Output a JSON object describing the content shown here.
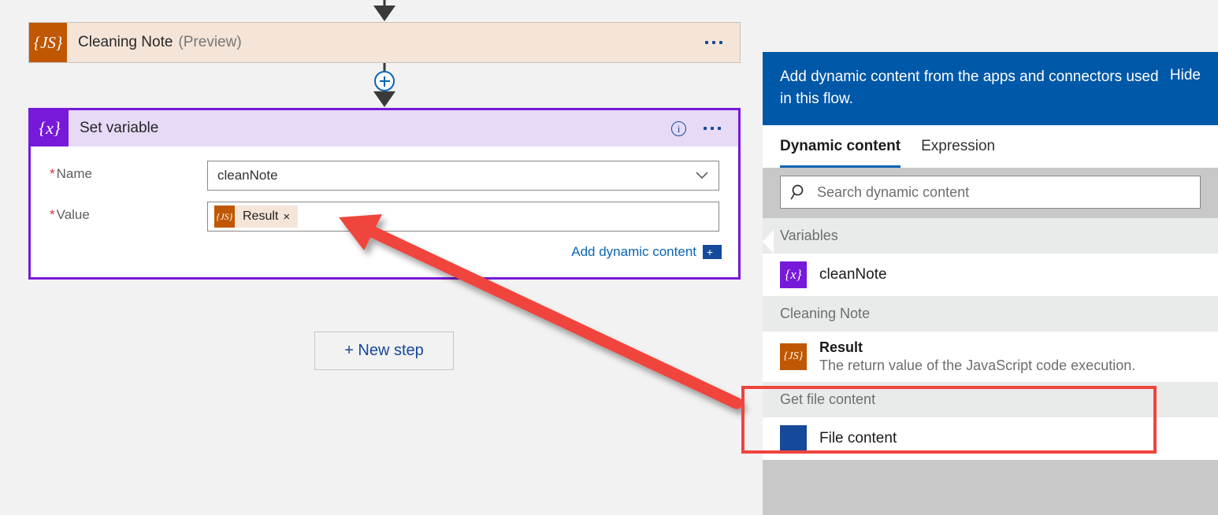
{
  "canvas": {
    "cards": {
      "cleaning_note": {
        "icon": "js-braces-icon",
        "title": "Cleaning Note",
        "subtitle": "(Preview)",
        "menu_icon": "ellipsis-icon"
      },
      "set_variable": {
        "icon": "variable-braces-icon",
        "title": "Set variable",
        "info_icon": "info-icon",
        "info_glyph": "i",
        "menu_icon": "ellipsis-icon",
        "fields": [
          {
            "required_marker": "*",
            "label": "Name",
            "value": "cleanNote",
            "control": "combobox",
            "chevron_icon": "chevron-down-icon"
          },
          {
            "required_marker": "*",
            "label": "Value",
            "control": "token-input",
            "token": {
              "icon": "js-braces-icon",
              "label": "Result",
              "remove_icon": "close-icon",
              "remove_glyph": "×"
            }
          }
        ],
        "add_dynamic_content": {
          "label": "Add dynamic content",
          "button_glyph": "+",
          "button_icon": "add-dynamic-content-icon"
        }
      }
    },
    "connector": {
      "plus_node_icon": "add-step-plus-icon",
      "arrow_icon": "flow-arrow-down-icon"
    },
    "new_step_button": {
      "label": "+ New step"
    },
    "annotation": {
      "arrow_icon": "red-pointer-arrow",
      "arrow_color": "#f0443e",
      "highlight_color": "#f0443e"
    }
  },
  "dynamic_content_panel": {
    "header": {
      "text": "Add dynamic content from the apps and connectors used in this flow.",
      "hide_label": "Hide",
      "background": "#0058a8"
    },
    "tabs": [
      {
        "label": "Dynamic content",
        "active": true
      },
      {
        "label": "Expression",
        "active": false
      }
    ],
    "search": {
      "placeholder": "Search dynamic content",
      "value": "",
      "icon": "search-icon"
    },
    "groups": [
      {
        "label": "Variables",
        "items": [
          {
            "icon": "variable-braces-icon",
            "icon_color": "#7719d9",
            "title": "cleanNote",
            "description": ""
          }
        ]
      },
      {
        "label": "Cleaning Note",
        "items": [
          {
            "icon": "js-braces-icon",
            "icon_color": "#c05702",
            "title": "Result",
            "description": "The return value of the JavaScript code execution.",
            "highlighted": true
          }
        ]
      },
      {
        "label": "Get file content",
        "items": [
          {
            "icon": "connector-icon",
            "icon_color": "#15499a",
            "title": "File content",
            "description": ""
          }
        ]
      }
    ]
  },
  "glyphs": {
    "js_braces": "{JS}",
    "variable_braces": "{x}"
  }
}
